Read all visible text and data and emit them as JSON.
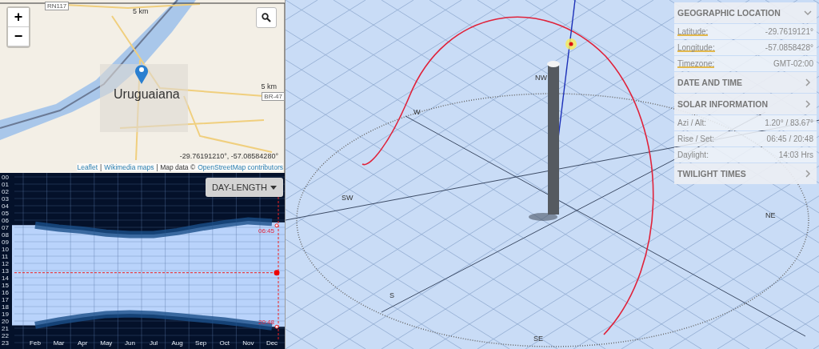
{
  "map": {
    "zoom_in": "+",
    "zoom_out": "−",
    "road_labels": [
      "RN117",
      "BR-47"
    ],
    "scale_labels": [
      "5 km",
      "5 km"
    ],
    "city": "Uruguaiana",
    "coordinates": "-29.76191210°, -57.08584280°",
    "attribution": [
      {
        "text": "Leaflet",
        "kind": "link"
      },
      {
        "text": "|",
        "kind": "text"
      },
      {
        "text": "Wikimedia maps",
        "kind": "link"
      },
      {
        "text": "| Map data ©",
        "kind": "text"
      },
      {
        "text": "OpenStreetMap contributors",
        "kind": "link"
      }
    ]
  },
  "day_length": {
    "dropdown": "DAY-LENGTH",
    "rise_label": "06:45",
    "set_label": "20:48",
    "chart_data": {
      "type": "line",
      "categories": [
        "Feb",
        "Mar",
        "Apr",
        "May",
        "Jun",
        "Jul",
        "Aug",
        "Sep",
        "Oct",
        "Nov",
        "Dec"
      ],
      "series": [
        {
          "color": "#1a4f8a",
          "values": [
            6.7,
            7.1,
            7.4,
            7.8,
            8.0,
            8.0,
            7.6,
            7.0,
            6.5,
            6.1,
            6.3
          ]
        },
        {
          "color": "#1a4f8a",
          "values": [
            20.6,
            20.0,
            19.5,
            19.1,
            19.0,
            19.1,
            19.4,
            19.7,
            20.0,
            20.4,
            20.8
          ]
        }
      ],
      "ylim": [
        23,
        0
      ],
      "grid": true,
      "ref_lines": [
        {
          "axis": "y",
          "value": 13.3
        },
        {
          "axis": "x",
          "value": "Dec"
        }
      ],
      "yticks": [
        {
          "value": 0,
          "label": "00"
        },
        {
          "value": 1,
          "label": "01"
        },
        {
          "value": 2,
          "label": "02"
        },
        {
          "value": 3,
          "label": "03"
        },
        {
          "value": 4,
          "label": "04"
        },
        {
          "value": 5,
          "label": "05"
        },
        {
          "value": 6,
          "label": "06"
        },
        {
          "value": 7,
          "label": "07"
        },
        {
          "value": 8,
          "label": "08"
        },
        {
          "value": 9,
          "label": "09"
        },
        {
          "value": 10,
          "label": "10"
        },
        {
          "value": 11,
          "label": "11"
        },
        {
          "value": 12,
          "label": "12"
        },
        {
          "value": 13,
          "label": "13"
        },
        {
          "value": 14,
          "label": "14"
        },
        {
          "value": 15,
          "label": "15"
        },
        {
          "value": 16,
          "label": "16"
        },
        {
          "value": 17,
          "label": "17"
        },
        {
          "value": 18,
          "label": "18"
        },
        {
          "value": 19,
          "label": "19"
        },
        {
          "value": 20,
          "label": "20"
        },
        {
          "value": 21,
          "label": "21"
        },
        {
          "value": 22,
          "label": "22"
        },
        {
          "value": 23,
          "label": "23"
        }
      ]
    }
  },
  "scene": {
    "compass_labels": [
      "NW",
      "W",
      "SW",
      "S",
      "SE",
      "NE"
    ]
  },
  "panel": [
    {
      "title": "GEOGRAPHIC LOCATION",
      "expanded": true,
      "rows": [
        {
          "label": "Latitude:",
          "value": "-29.7619121°",
          "underlined": true
        },
        {
          "label": "Longitude:",
          "value": "-57.0858428°",
          "underlined": true
        },
        {
          "label": "Timezone:",
          "value": "GMT-02:00",
          "underlined": true
        }
      ]
    },
    {
      "title": "DATE AND TIME",
      "expanded": false
    },
    {
      "title": "SOLAR INFORMATION",
      "expanded": false,
      "rows": [
        {
          "label": "Azi / Alt:",
          "value": "1.20° / 83.67°",
          "underlined": false
        },
        {
          "label": "Rise / Set:",
          "value": "06:45 / 20:48",
          "underlined": false
        },
        {
          "label": "Daylight:",
          "value": "14:03 Hrs",
          "underlined": false
        }
      ]
    },
    {
      "title": "TWILIGHT TIMES",
      "expanded": false
    }
  ]
}
